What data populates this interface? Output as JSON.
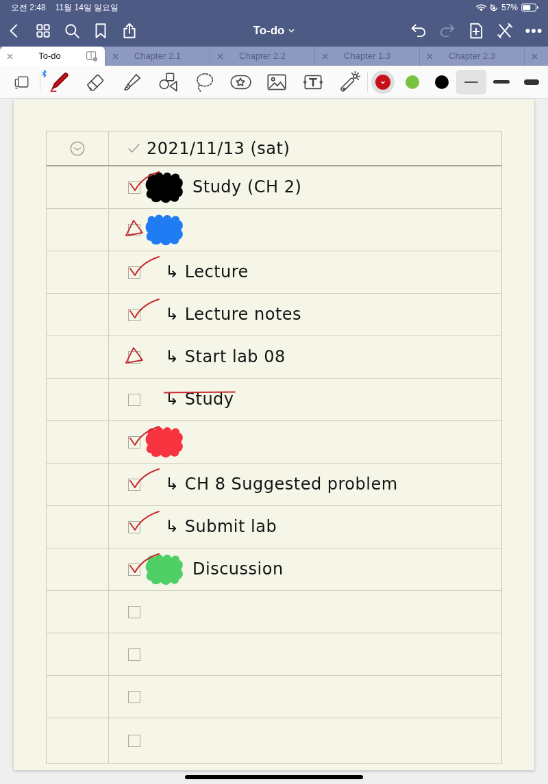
{
  "status_bar": {
    "time": "오전 2:48",
    "date": "11월 14일 일요일",
    "battery": "57%"
  },
  "nav_bar": {
    "left_actions": [
      {
        "kind": "back",
        "disabled": false
      },
      {
        "kind": "thumbnails",
        "disabled": false
      },
      {
        "kind": "search",
        "disabled": false
      },
      {
        "kind": "bookmark",
        "disabled": false
      },
      {
        "kind": "share",
        "disabled": false
      }
    ],
    "title": "To-do",
    "right_actions": [
      {
        "kind": "undo",
        "disabled": false
      },
      {
        "kind": "redo",
        "disabled": true
      },
      {
        "kind": "add-page",
        "disabled": false
      },
      {
        "kind": "cross",
        "disabled": false
      },
      {
        "kind": "more",
        "disabled": false
      }
    ]
  },
  "tabs": [
    {
      "label": "To-do",
      "selected": true
    },
    {
      "label": "Chapter 2.1",
      "selected": false
    },
    {
      "label": "Chapter 2.2",
      "selected": false
    },
    {
      "label": "Chapter 1.3",
      "selected": false
    },
    {
      "label": "Chapter 2.3",
      "selected": false
    },
    {
      "selected": false
    }
  ],
  "toolbar": {
    "tools": [
      {
        "kind": "pen",
        "selected": true
      },
      {
        "kind": "eraser",
        "selected": false
      },
      {
        "kind": "highlighter",
        "selected": false
      },
      {
        "kind": "shapes",
        "selected": false
      },
      {
        "kind": "lasso",
        "selected": false
      },
      {
        "kind": "sticker",
        "selected": false
      },
      {
        "kind": "image",
        "selected": false
      },
      {
        "kind": "text-box",
        "selected": false
      },
      {
        "kind": "laser-pointer",
        "selected": false
      }
    ],
    "colors": [
      {
        "color": "#c8101a",
        "selected": true
      },
      {
        "color": "#7cc242",
        "selected": false
      },
      {
        "color": "#000000",
        "selected": false
      }
    ],
    "widths": [
      {
        "kind": "fine",
        "selected": true
      },
      {
        "kind": "medium",
        "selected": false
      },
      {
        "kind": "thick",
        "selected": false
      }
    ]
  },
  "page": {
    "header": {
      "date": "2021/11/13 (sat)"
    },
    "rows": [
      {
        "checked": true,
        "in_progress": false,
        "scribble": {
          "color": "#000000"
        },
        "text": "Study (CH 2)",
        "struck": false
      },
      {
        "checked": false,
        "in_progress": true,
        "scribble": {
          "color": "#1f7cf2"
        }
      },
      {
        "checked": true,
        "in_progress": false,
        "text": "↳ Lecture",
        "struck": false
      },
      {
        "checked": true,
        "in_progress": false,
        "text": "↳ Lecture notes",
        "struck": false
      },
      {
        "checked": false,
        "in_progress": true,
        "text": "↳ Start lab 08",
        "struck": false
      },
      {
        "checked": false,
        "in_progress": false,
        "text": "↳ Study",
        "struck": true
      },
      {
        "checked": true,
        "in_progress": false,
        "scribble": {
          "color": "#f7333f"
        }
      },
      {
        "checked": true,
        "in_progress": false,
        "text": "↳ CH 8 Suggested problem",
        "struck": false
      },
      {
        "checked": true,
        "in_progress": false,
        "text": "↳ Submit lab",
        "struck": false
      },
      {
        "checked": true,
        "in_progress": false,
        "scribble": {
          "color": "#4fd067"
        },
        "text": "Discussion",
        "struck": false
      },
      {
        "checked": false,
        "in_progress": false
      },
      {
        "checked": false,
        "in_progress": false
      },
      {
        "checked": false,
        "in_progress": false
      },
      {
        "checked": false,
        "in_progress": false
      }
    ]
  }
}
